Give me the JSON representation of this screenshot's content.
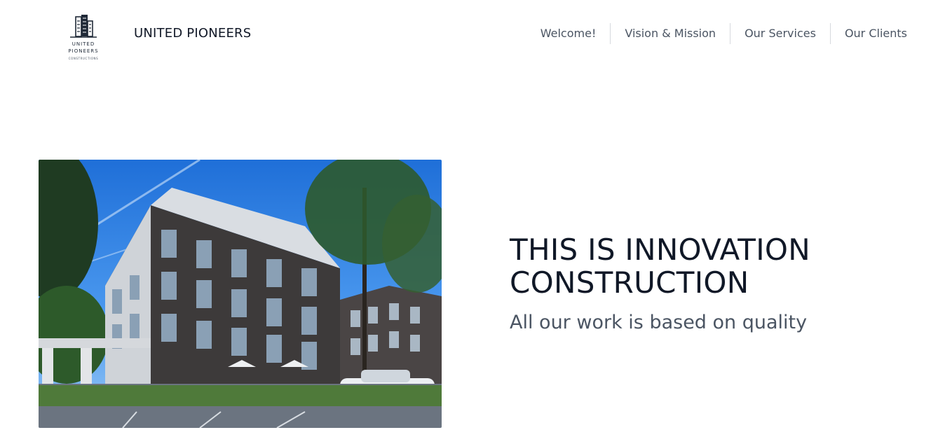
{
  "header": {
    "logo": {
      "icon": "building-logo-icon",
      "line1": "UNITED",
      "line2": "PIONEERS",
      "line3": "CONSTRUCTIONS"
    },
    "brand": "UNITED PIONEERS",
    "nav": [
      {
        "label": "Welcome!"
      },
      {
        "label": "Vision & Mission"
      },
      {
        "label": "Our Services"
      },
      {
        "label": "Our Clients"
      }
    ]
  },
  "hero": {
    "image_icon": "apartment-building-photo",
    "headline_line1": "THIS IS INNOVATION",
    "headline_line2": "CONSTRUCTION",
    "subtitle": "All our work is based on quality"
  },
  "colors": {
    "text_primary": "#111827",
    "text_muted": "#4b5563",
    "nav_divider": "#d6d9de",
    "background": "#ffffff"
  }
}
